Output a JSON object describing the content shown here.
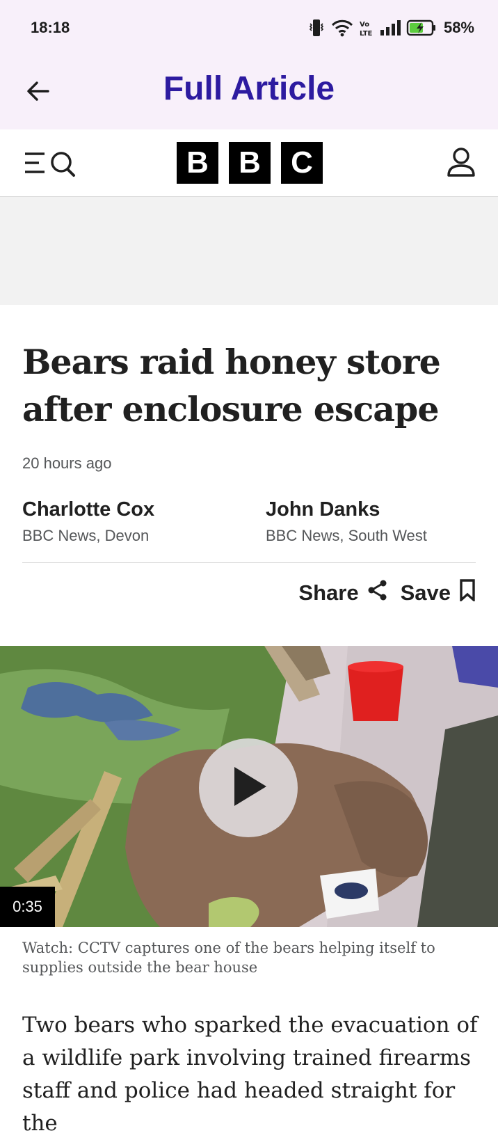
{
  "status_bar": {
    "time": "18:18",
    "battery": "58%",
    "icons": [
      "vibrate-icon",
      "wifi-icon",
      "volte-icon",
      "signal-icon",
      "battery-charging-icon"
    ]
  },
  "app_bar": {
    "title": "Full Article",
    "back_icon": "arrow-left-icon"
  },
  "bbc_header": {
    "logo_letters": [
      "B",
      "B",
      "C"
    ],
    "menu_icon": "menu-search-icon",
    "account_icon": "account-icon"
  },
  "article": {
    "headline": "Bears raid honey store after enclosure escape",
    "timestamp": "20 hours ago",
    "authors": [
      {
        "name": "Charlotte Cox",
        "org": "BBC News, Devon"
      },
      {
        "name": "John Danks",
        "org": "BBC News, South West"
      }
    ],
    "share_label": "Share",
    "save_label": "Save",
    "video": {
      "duration": "0:35",
      "caption": "Watch: CCTV captures one of the bears helping itself to supplies outside the bear house"
    },
    "body": "Two bears who sparked the evacuation of a wildlife park involving trained firearms staff and police had headed straight for the"
  },
  "colors": {
    "app_bar_bg": "#f8f0fa",
    "title": "#2d1ba0",
    "bbc_black": "#000000"
  }
}
